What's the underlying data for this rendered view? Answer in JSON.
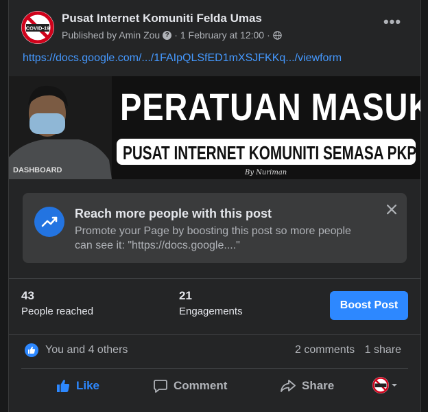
{
  "post": {
    "page_name": "Pusat Internet Komuniti Felda Umas",
    "published_by": "Published by Amin Zou",
    "date": "1 February at 12:00",
    "separator": "·",
    "link_text": "https://docs.google.com/.../1FAIpQLSfED1mXSJFKKq.../viewform",
    "avatar_text": "COVID-19"
  },
  "banner": {
    "title": "PERATUAN MASUK",
    "subtitle": "PUSAT INTERNET KOMUNITI SEMASA PKP",
    "credit": "By Nuriman",
    "shirt_text": "DASHBOARD"
  },
  "promo": {
    "title": "Reach more people with this post",
    "description": "Promote your Page by boosting this post so more people can see it: \"https://docs.google....\""
  },
  "insights": {
    "reached_count": "43",
    "reached_label": "People reached",
    "engagements_count": "21",
    "engagements_label": "Engagements",
    "boost_label": "Boost Post"
  },
  "reactions": {
    "text": "You and 4 others",
    "comments": "2 comments",
    "shares": "1 share"
  },
  "actions": {
    "like": "Like",
    "comment": "Comment",
    "share": "Share"
  },
  "colors": {
    "accent": "#2d88ff",
    "link": "#4599ff",
    "card_bg": "#242526"
  }
}
